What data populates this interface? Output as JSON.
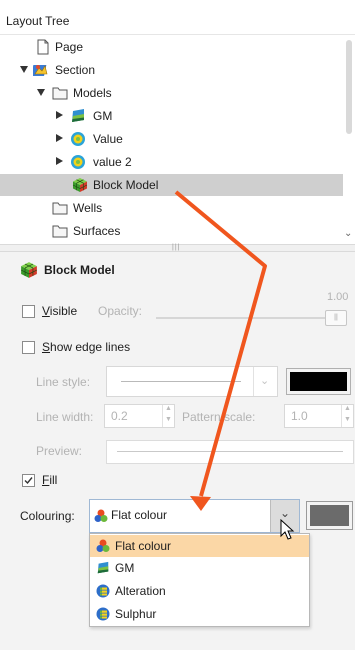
{
  "tree": {
    "header": "Layout Tree",
    "items": [
      {
        "label": "Page",
        "icon": "page-icon"
      },
      {
        "label": "Section",
        "icon": "section-icon"
      },
      {
        "label": "Models",
        "icon": "folder-icon"
      },
      {
        "label": "GM",
        "icon": "geological-model-icon"
      },
      {
        "label": "Value",
        "icon": "numeric-model-icon"
      },
      {
        "label": "value 2",
        "icon": "numeric-model-icon"
      },
      {
        "label": "Block Model",
        "icon": "block-model-icon"
      },
      {
        "label": "Wells",
        "icon": "folder-icon"
      },
      {
        "label": "Surfaces",
        "icon": "folder-icon"
      }
    ]
  },
  "properties": {
    "title": "Block Model",
    "visible_label": "Visible",
    "visible_checked": false,
    "opacity_label": "Opacity:",
    "opacity_value": "1.00",
    "show_edge_lines_label": "Show edge lines",
    "show_edge_lines_checked": false,
    "line_style_label": "Line style:",
    "line_width_label": "Line width:",
    "line_width_value": "0.2",
    "pattern_scale_label": "Pattern scale:",
    "pattern_scale_value": "1.0",
    "preview_label": "Preview:",
    "fill_label": "Fill",
    "fill_checked": true,
    "colouring_label": "Colouring:",
    "colouring_value": "Flat colour",
    "line_colour": "#000000",
    "fill_colour": "#6b6b6b"
  },
  "dropdown": {
    "options": [
      {
        "label": "Flat colour",
        "icon": "flat-colour-icon"
      },
      {
        "label": "GM",
        "icon": "geological-model-icon"
      },
      {
        "label": "Alteration",
        "icon": "category-icon"
      },
      {
        "label": "Sulphur",
        "icon": "category-icon"
      }
    ],
    "highlighted": "Flat colour"
  },
  "colors": {
    "annotation_arrow": "#f0561e",
    "selection_highlight": "#cfcfcf",
    "dropdown_highlight": "#fbd7a6"
  }
}
